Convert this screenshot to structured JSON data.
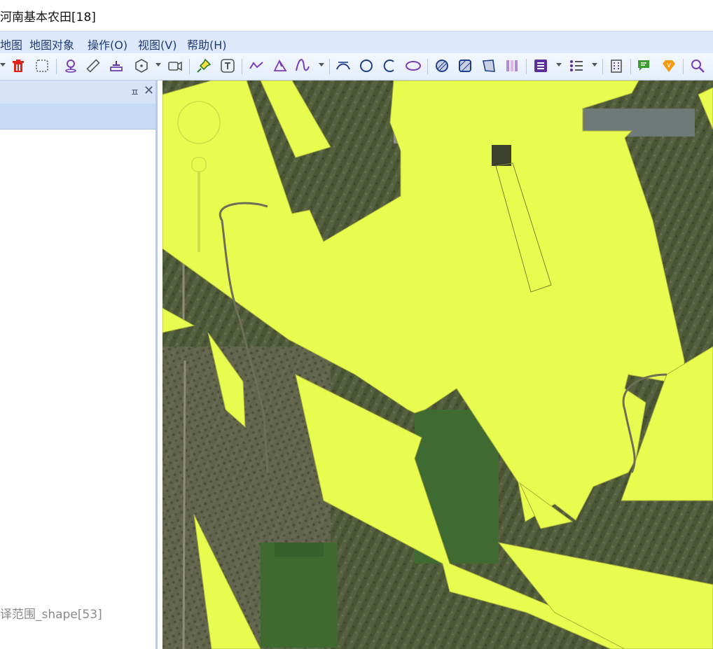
{
  "window": {
    "title": "河南基本农田[18]"
  },
  "menu": {
    "items": [
      "地图",
      "地图对象",
      "操作(O)",
      "视图(V)",
      "帮助(H)"
    ]
  },
  "toolbar": {
    "icons": [
      "delete-icon",
      "rectangle-select-icon",
      "location-pin-icon",
      "measure-icon",
      "area-ruler-icon",
      "3d-cube-icon",
      "camera-icon",
      "pushpin-icon",
      "text-icon",
      "polyline-icon",
      "polygon-icon",
      "curve-icon",
      "arc-icon",
      "circle-icon",
      "arc-open-icon",
      "ellipse-icon",
      "hatch-circle-icon",
      "hatch-square-icon",
      "hatch-poly-icon",
      "barcode-icon",
      "layer-book-icon",
      "list-icon",
      "building-icon",
      "chat-icon",
      "vip-diamond-icon",
      "search-icon"
    ]
  },
  "panel": {
    "pin_glyph": "ㅍ",
    "close_glyph": "✕",
    "layer_label": "译范围_shape[53]"
  },
  "colors": {
    "polygon_fill": "#e8fb4f",
    "menubar_bg": "#dde9fa",
    "panel_header_bg": "#d7e4f7",
    "imagery_dark": "#4f5a3d"
  }
}
